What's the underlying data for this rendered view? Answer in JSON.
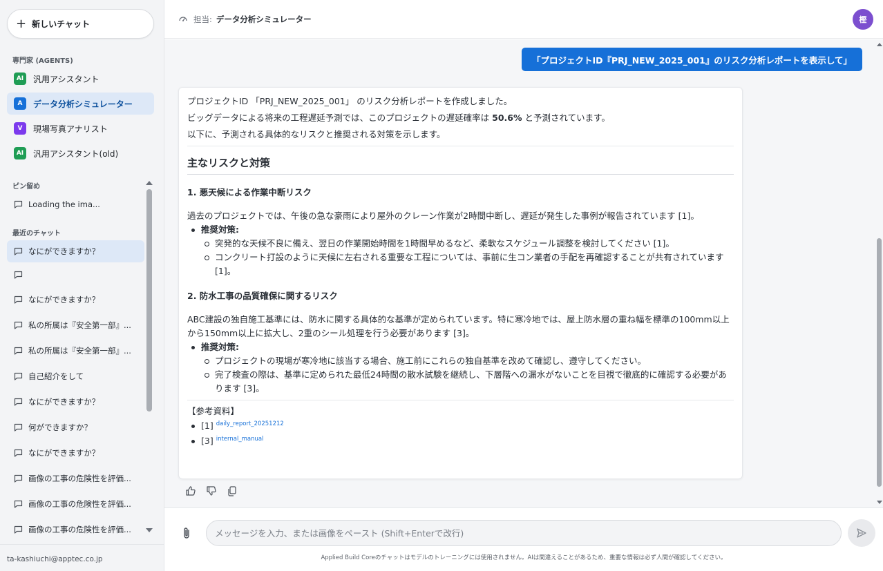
{
  "sidebar": {
    "new_chat_label": "新しいチャット",
    "agents_label": "専門家 (AGENTS)",
    "agents": [
      {
        "badge": "AI",
        "label": "汎用アシスタント",
        "color": "#1f9d55"
      },
      {
        "badge": "A",
        "label": "データ分析シミュレーター",
        "color": "#1670d8"
      },
      {
        "badge": "V",
        "label": "現場写真アナリスト",
        "color": "#7c3aed"
      },
      {
        "badge": "AI",
        "label": "汎用アシスタント(old)",
        "color": "#1f9d55"
      }
    ],
    "pinned_label": "ピン留め",
    "pinned": [
      {
        "label": "Loading the ima..."
      }
    ],
    "recent_label": "最近のチャット",
    "recent": [
      {
        "label": "なにができますか？"
      },
      {
        "label": ""
      },
      {
        "label": "なにができますか？"
      },
      {
        "label": "私の所属は『安全第一部』..."
      },
      {
        "label": "私の所属は『安全第一部』..."
      },
      {
        "label": "自己紹介をして"
      },
      {
        "label": "なにができますか？"
      },
      {
        "label": "何ができますか？"
      },
      {
        "label": "なにができますか？"
      },
      {
        "label": "画像の工事の危険性を評価..."
      },
      {
        "label": "画像の工事の危険性を評価..."
      },
      {
        "label": "画像の工事の危険性を評価..."
      }
    ],
    "user_email": "ta-kashiuchi@apptec.co.jp"
  },
  "header": {
    "assignee_label": "担当:",
    "title": "データ分析シミュレーター",
    "avatar_initial": "樫"
  },
  "conversation": {
    "user_message": "「プロジェクトID『PRJ_NEW_2025_001』のリスク分析レポートを表示して」",
    "intro": [
      "プロジェクトID 「PRJ_NEW_2025_001」 のリスク分析レポートを作成しました。",
      "以下に、予測される具体的なリスクと推奨される対策を示します。"
    ],
    "prediction_prefix": "ビッグデータによる将来の工程遅延予測では、このプロジェクトの遅延確率は",
    "prediction_value": "50.6%",
    "prediction_suffix": "と予測されています。",
    "section_title": "主なリスクと対策",
    "risks": [
      {
        "title": "1. 悪天候による作業中断リスク",
        "body": "過去のプロジェクトでは、午後の急な豪雨により屋外のクレーン作業が2時間中断し、遅延が発生した事例が報告されています [1]。",
        "measures_label": "推奨対策:",
        "measures": [
          "突発的な天候不良に備え、翌日の作業開始時間を1時間早めるなど、柔軟なスケジュール調整を検討してください [1]。",
          "コンクリート打設のように天候に左右される重要な工程については、事前に生コン業者の手配を再確認することが共有されています [1]。"
        ]
      },
      {
        "title": "2. 防水工事の品質確保に関するリスク",
        "body": "ABC建設の独自施工基準には、防水に関する具体的な基準が定められています。特に寒冷地では、屋上防水層の重ね幅を標準の100mm以上から150mm以上に拡大し、2重のシール処理を行う必要があります [3]。",
        "measures_label": "推奨対策:",
        "measures": [
          "プロジェクトの現場が寒冷地に該当する場合、施工前にこれらの独自基準を改めて確認し、遵守してください。",
          "完了検査の際は、基準に定められた最低24時間の散水試験を継続し、下層階への漏水がないことを目視で徹底的に確認する必要があります [3]。"
        ]
      }
    ],
    "references_title": "【参考資料】",
    "references": [
      {
        "num": "[1]",
        "link": "daily_report_20251212"
      },
      {
        "num": "[3]",
        "link": "internal_manual"
      }
    ]
  },
  "input": {
    "placeholder": "メッセージを入力、または画像をペースト (Shift+Enterで改行)",
    "disclaimer": "Applied Build Coreのチャットはモデルのトレーニングには使用されません。AIは間違えることがあるため、重要な情報は必ず人間が確認してください。"
  },
  "colors": {
    "accent": "#1670d8",
    "active_bg": "#dde8f7",
    "avatar": "#7c4fcf"
  }
}
